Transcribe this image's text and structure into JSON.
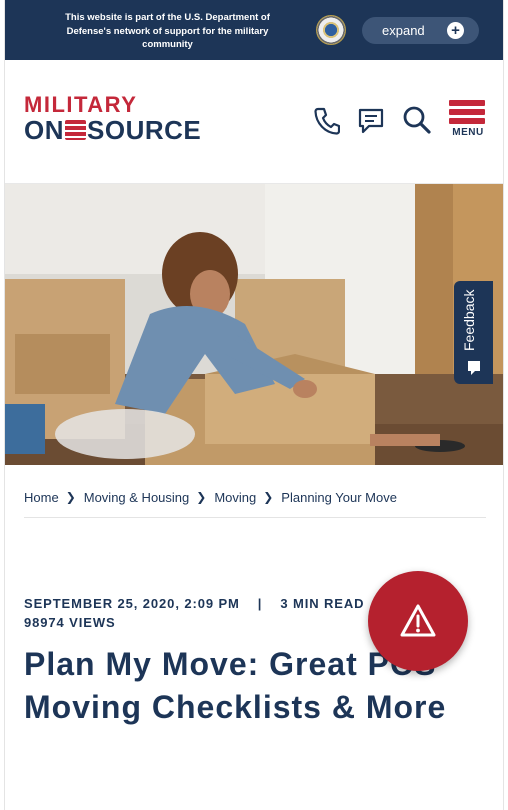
{
  "banner": {
    "text": "This website is part of the U.S. Department of Defense's network of support for the military community",
    "expand_label": "expand",
    "expand_icon": "plus-icon"
  },
  "header": {
    "logo_top": "MILITARY",
    "logo_bottom_left": "ON",
    "logo_bottom_right": "SOURCE",
    "icons": [
      "phone-icon",
      "chat-icon",
      "search-icon",
      "menu-icon"
    ],
    "menu_label": "MENU"
  },
  "colors": {
    "navy": "#1d3557",
    "red": "#c4283a",
    "alert_red": "#b5212e"
  },
  "feedback": {
    "label": "Feedback"
  },
  "breadcrumb": [
    "Home",
    "Moving & Housing",
    "Moving",
    "Planning Your Move"
  ],
  "article": {
    "date": "SEPTEMBER 25, 2020, 2:09 PM",
    "separator": "|",
    "read_time": "3 MIN READ",
    "views": "98974 VIEWS",
    "title": "Plan My Move: Great PCS Moving Checklists & More"
  }
}
